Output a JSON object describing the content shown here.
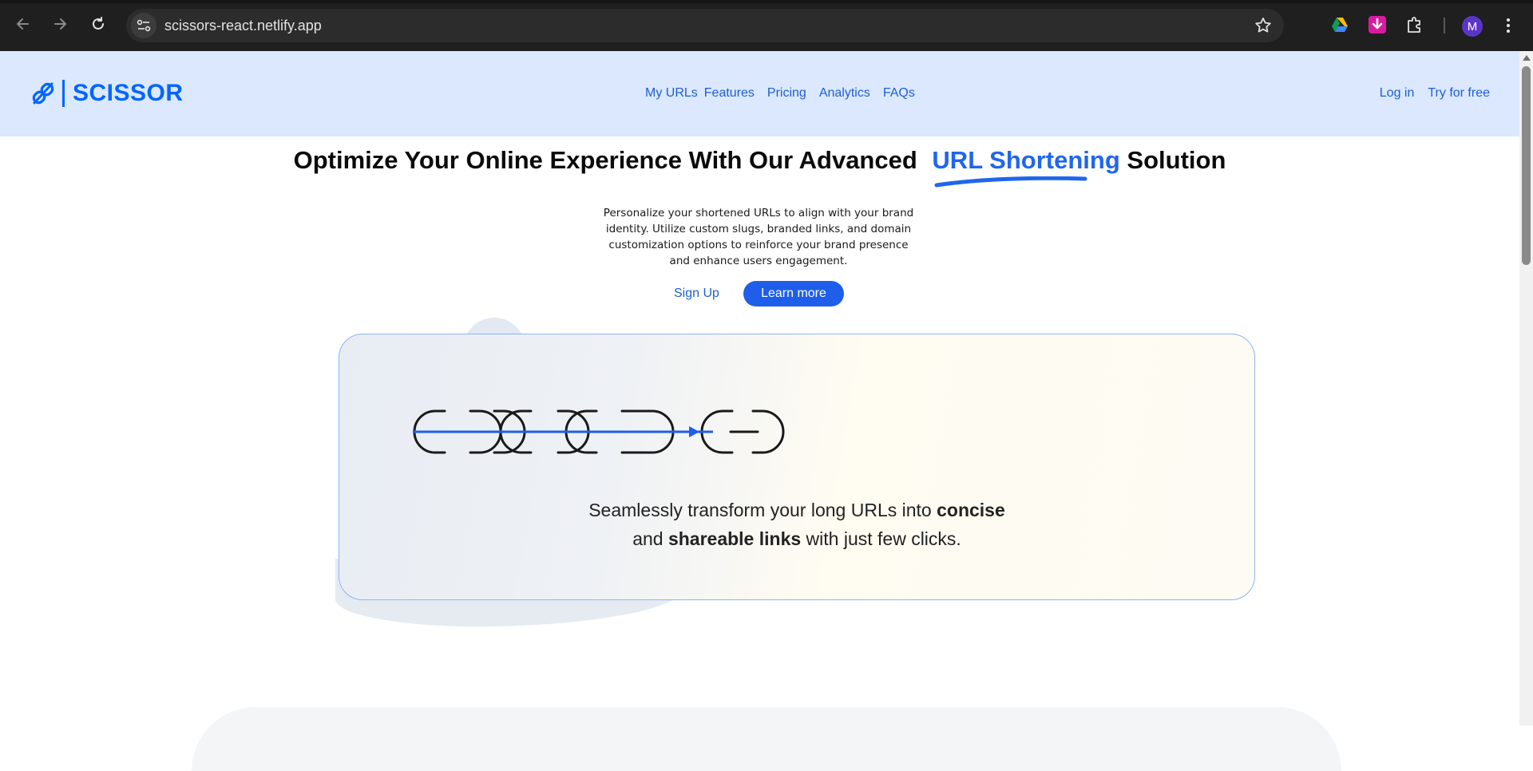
{
  "browser": {
    "url": "scissors-react.netlify.app",
    "profile_initial": "M",
    "icons": [
      "back-arrow-icon",
      "forward-arrow-icon",
      "reload-icon",
      "site-info-icon",
      "bookmark-star-icon",
      "google-drive-icon",
      "download-extension-icon",
      "extensions-puzzle-icon",
      "menu-kebab-icon"
    ]
  },
  "header": {
    "logo_text": "SCISSOR",
    "nav": [
      "My URLs",
      "Features",
      "Pricing",
      "Analytics",
      "FAQs"
    ],
    "login": "Log in",
    "try_free": "Try for free"
  },
  "hero": {
    "title_before": "Optimize Your Online Experience With Our Advanced",
    "title_accent": "URL Shortening",
    "title_after": "Solution",
    "description": "Personalize your shortened URLs to align with your brand identity. Utilize custom slugs, branded links, and domain customization options to reinforce your brand presence and enhance users engagement.",
    "signup": "Sign Up",
    "learn_more": "Learn more"
  },
  "illustration": {
    "line1_a": "Seamlessly transform your long URLs into",
    "line1_b": "concise",
    "line2_a": "and",
    "line2_b": "shareable links",
    "line2_c": "with just few clicks."
  },
  "colors": {
    "brand": "#0065fe",
    "header_bg": "#dbe8fd",
    "button_bg": "#1e5eea",
    "link": "#1d5fd6"
  }
}
